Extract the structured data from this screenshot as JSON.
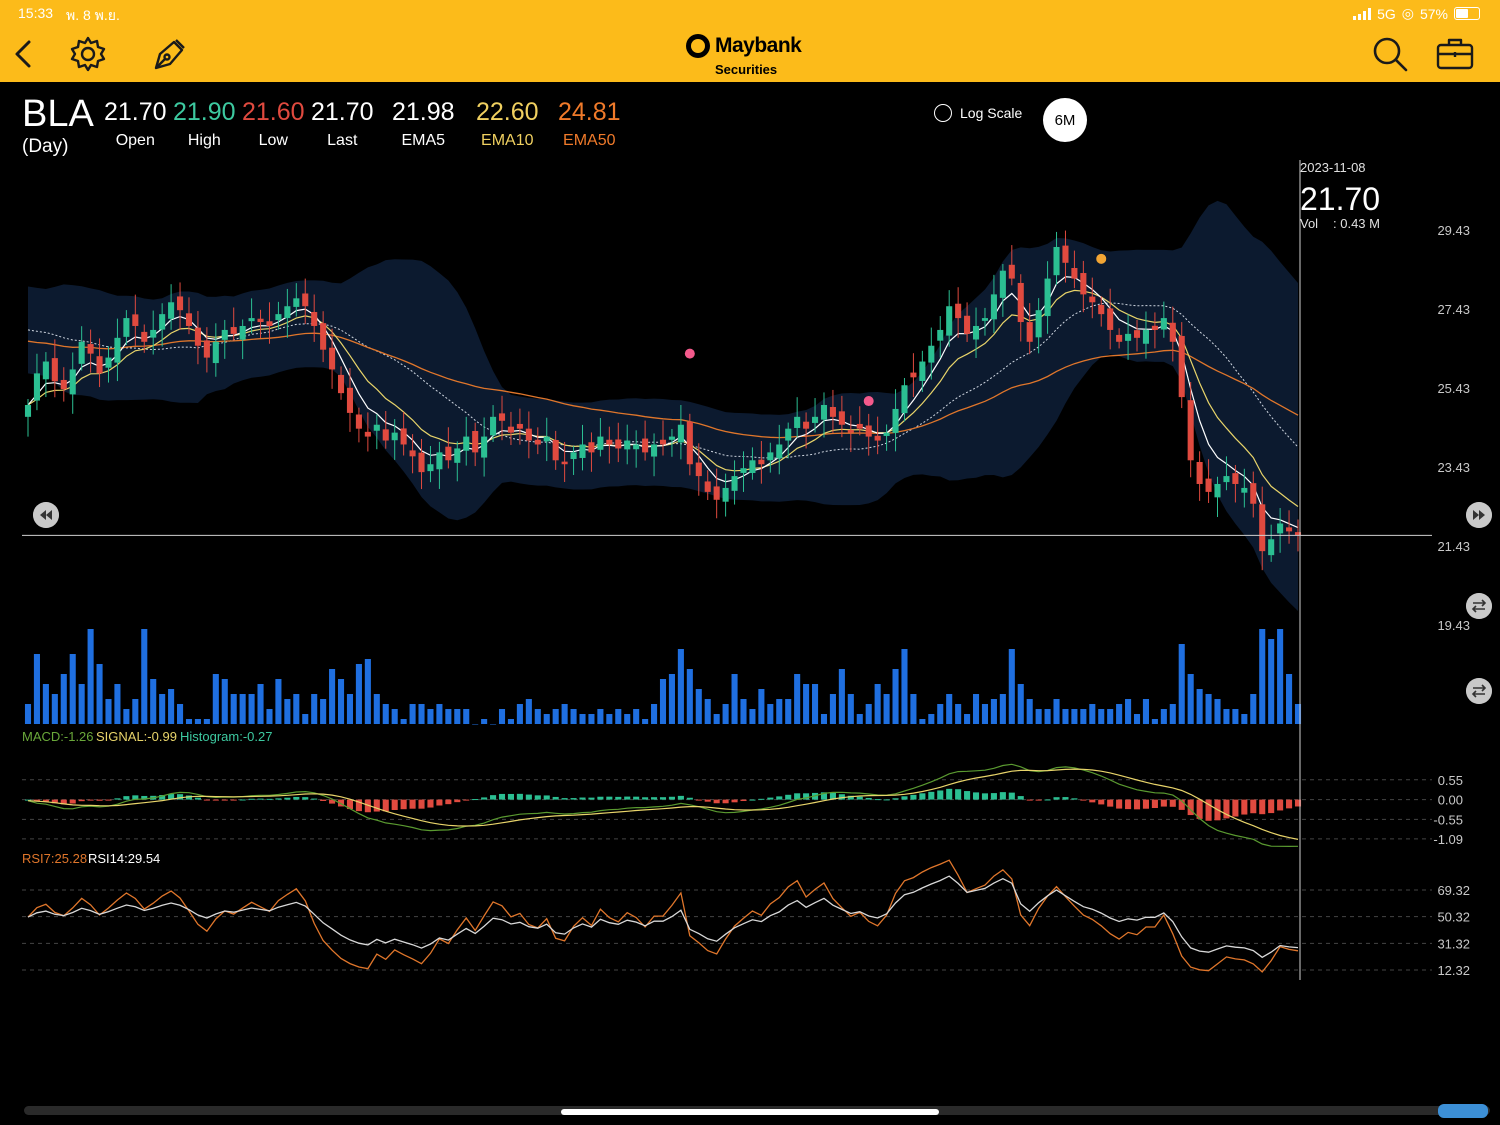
{
  "status_bar": {
    "time": "15:33",
    "date": "พ. 8 พ.ย.",
    "network": "5G",
    "battery": "57%"
  },
  "app_bar": {
    "icons": [
      "back-chevron-icon",
      "gear-icon",
      "pen-tool-icon",
      "search-icon",
      "briefcase-icon"
    ],
    "brand": "Maybank",
    "brand_sub": "Securities",
    "brand_color": "#fcbb1a"
  },
  "quote": {
    "symbol": "BLA",
    "period": "(Day)",
    "fields": [
      {
        "value": "21.70",
        "label": "Open",
        "color": "#ffffff"
      },
      {
        "value": "21.90",
        "label": "High",
        "color": "#3dc9a0"
      },
      {
        "value": "21.60",
        "label": "Low",
        "color": "#e04a3f"
      },
      {
        "value": "21.70",
        "label": "Last",
        "color": "#ffffff"
      },
      {
        "value": "21.98",
        "label": "EMA5",
        "color": "#ffffff"
      },
      {
        "value": "22.60",
        "label": "EMA10",
        "color": "#f0d060"
      },
      {
        "value": "24.81",
        "label": "EMA50",
        "color": "#f07a2a"
      }
    ]
  },
  "controls": {
    "log_scale_label": "Log Scale",
    "period_button": "6M"
  },
  "crosshair": {
    "date": "2023-11-08",
    "price": "21.70",
    "vol_label": "Vol",
    "vol_value": ": 0.43 M"
  },
  "chart_data": [
    {
      "type": "candlestick",
      "price_axis_ticks": [
        29.43,
        27.43,
        25.43,
        23.43,
        21.43,
        19.43
      ],
      "ylim": [
        19.43,
        29.43
      ],
      "close": [
        25.0,
        25.8,
        26.1,
        25.6,
        25.4,
        25.9,
        26.6,
        26.3,
        25.8,
        26.2,
        26.7,
        27.2,
        27.0,
        26.6,
        26.9,
        27.3,
        27.6,
        27.4,
        27.0,
        26.5,
        26.2,
        26.6,
        26.9,
        26.8,
        27.0,
        27.2,
        27.1,
        27.0,
        27.3,
        27.5,
        27.7,
        27.5,
        27.0,
        26.4,
        25.9,
        25.3,
        24.8,
        24.4,
        24.2,
        24.5,
        24.1,
        24.3,
        24.0,
        23.7,
        23.3,
        23.5,
        23.8,
        23.6,
        23.9,
        24.2,
        23.8,
        24.2,
        24.7,
        24.6,
        24.3,
        24.4,
        24.1,
        24.0,
        24.2,
        23.6,
        23.5,
        23.8,
        24.0,
        23.8,
        24.2,
        24.0,
        23.9,
        24.1,
        24.0,
        23.8,
        24.0,
        24.0,
        24.2,
        24.5,
        23.5,
        23.2,
        22.8,
        22.6,
        22.9,
        23.2,
        23.4,
        23.6,
        23.5,
        23.8,
        24.0,
        24.4,
        24.7,
        24.4,
        24.7,
        25.0,
        24.7,
        24.5,
        24.3,
        24.4,
        24.2,
        24.1,
        24.3,
        24.9,
        25.5,
        25.7,
        26.1,
        26.5,
        26.9,
        27.5,
        27.2,
        26.8,
        27.0,
        27.2,
        27.8,
        28.4,
        28.2,
        27.1,
        26.6,
        27.4,
        28.2,
        29.0,
        28.6,
        28.2,
        27.8,
        27.6,
        27.3,
        26.9,
        26.6,
        26.8,
        26.7,
        26.9,
        26.9,
        27.2,
        26.6,
        25.2,
        23.6,
        23.0,
        22.8,
        23.0,
        23.2,
        23.0,
        22.9,
        22.5,
        21.3,
        21.6,
        22.0,
        21.8,
        21.7
      ],
      "vol": [
        0.4,
        1.4,
        0.8,
        0.6,
        1.0,
        1.4,
        0.8,
        1.9,
        1.2,
        0.5,
        0.8,
        0.3,
        0.5,
        1.9,
        0.9,
        0.6,
        0.7,
        0.4,
        0.1,
        0.1,
        0.1,
        1.0,
        0.9,
        0.6,
        0.6,
        0.6,
        0.8,
        0.3,
        0.9,
        0.5,
        0.6,
        0.2,
        0.6,
        0.5,
        1.1,
        0.9,
        0.6,
        1.2,
        1.3,
        0.6,
        0.4,
        0.3,
        0.1,
        0.4,
        0.4,
        0.3,
        0.4,
        0.3,
        0.3,
        0.3,
        0.0,
        0.1,
        0.0,
        0.3,
        0.1,
        0.4,
        0.5,
        0.3,
        0.2,
        0.3,
        0.4,
        0.3,
        0.2,
        0.2,
        0.3,
        0.2,
        0.3,
        0.2,
        0.3,
        0.1,
        0.4,
        0.9,
        1.0,
        1.5,
        1.1,
        0.7,
        0.5,
        0.2,
        0.4,
        1.0,
        0.5,
        0.3,
        0.7,
        0.4,
        0.5,
        0.5,
        1.0,
        0.8,
        0.8,
        0.2,
        0.6,
        1.1,
        0.6,
        0.2,
        0.4,
        0.8,
        0.6,
        1.1,
        1.5,
        0.6,
        0.1,
        0.2,
        0.4,
        0.6,
        0.4,
        0.2,
        0.6,
        0.4,
        0.5,
        0.6,
        1.5,
        0.8,
        0.5,
        0.3,
        0.3,
        0.5,
        0.3,
        0.3,
        0.3,
        0.4,
        0.3,
        0.3,
        0.4,
        0.5,
        0.2,
        0.5,
        0.1,
        0.3,
        0.4,
        1.6,
        1.0,
        0.7,
        0.6,
        0.5,
        0.3,
        0.3,
        0.2,
        0.6,
        1.9,
        1.7,
        1.9,
        1.0,
        0.4,
        0.1
      ]
    },
    {
      "type": "line",
      "title": "MACD",
      "values": {
        "MACD": "-1.26",
        "SIGNAL": "-0.99",
        "Histogram": "-0.27"
      },
      "axis_ticks": [
        "0.55",
        "0.00",
        "-0.55",
        "-1.09"
      ],
      "ylim": [
        -1.4,
        1.1
      ]
    },
    {
      "type": "line",
      "title": "RSI",
      "values": {
        "RSI7": "25.28",
        "RSI14": "29.54"
      },
      "axis_ticks": [
        "69.32",
        "50.32",
        "31.32",
        "12.32"
      ],
      "ylim": [
        0,
        100
      ]
    }
  ],
  "colors": {
    "up": "#2bbf92",
    "down": "#e04a3f",
    "volume": "#1f6fe0",
    "band": "#0c1a2f",
    "ema10": "#e8d46a",
    "ema50": "#e0762b",
    "macd_line": "#5a9a30",
    "signal_line": "#e8d46a",
    "rsi7": "#e0762b",
    "rsi14": "#d8d8d8"
  },
  "markers": [
    {
      "index": 74,
      "price": 26.3,
      "color": "#f45a8c"
    },
    {
      "index": 94,
      "price": 25.1,
      "color": "#f45a8c"
    },
    {
      "index": 120,
      "price": 28.7,
      "color": "#f2a534"
    }
  ]
}
